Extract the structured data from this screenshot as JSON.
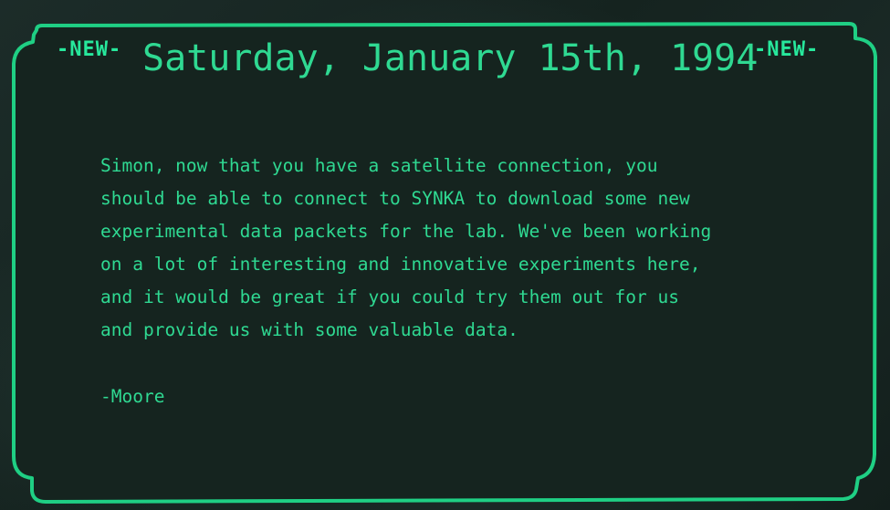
{
  "email": {
    "new_badge_left": "-NEW-",
    "new_badge_right": "-NEW-",
    "date": "Saturday, January 15th, 1994",
    "body_lines": [
      "Simon, now that you have a satellite connection, you",
      "should be able to connect to SYNKA to download some new",
      "experimental data packets for the lab. We've been working",
      "on a lot of interesting and innovative experiments here,",
      "and it would be great if you could try them out for us",
      "and provide us with some valuable data."
    ],
    "signature": "-Moore"
  },
  "colors": {
    "accent": "#27e89c",
    "text": "#2fd992",
    "frame": "#1fcf84",
    "panel": "#15241f",
    "background": "#13221f"
  }
}
